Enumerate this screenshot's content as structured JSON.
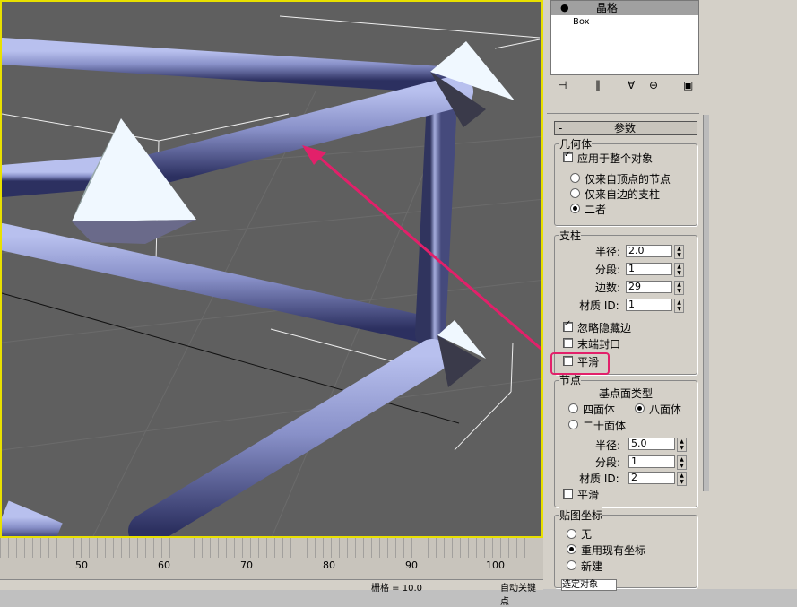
{
  "modifier_stack": {
    "items": [
      "晶格",
      "Box"
    ]
  },
  "rollout": {
    "title": "参数",
    "collapse": "-"
  },
  "geometry": {
    "title": "几何体",
    "apply_all": "应用于整个对象",
    "opt_vertices": "仅来自顶点的节点",
    "opt_edges": "仅来自边的支柱",
    "opt_both": "二者"
  },
  "struts": {
    "title": "支柱",
    "radius_label": "半径:",
    "radius": "2.0",
    "segments_label": "分段:",
    "segments": "1",
    "sides_label": "边数:",
    "sides": "29",
    "matid_label": "材质 ID:",
    "matid": "1",
    "ignore_hidden": "忽略隐藏边",
    "end_caps": "末端封口",
    "smooth": "平滑"
  },
  "joints": {
    "title": "节点",
    "base_type": "基点面类型",
    "tetra": "四面体",
    "octa": "八面体",
    "icosa": "二十面体",
    "radius_label": "半径:",
    "radius": "5.0",
    "segments_label": "分段:",
    "segments": "1",
    "matid_label": "材质 ID:",
    "matid": "2",
    "smooth": "平滑"
  },
  "mapping": {
    "title": "贴图坐标",
    "none": "无",
    "reuse": "重用现有坐标",
    "new": "新建"
  },
  "timeline": {
    "ticks": [
      "50",
      "60",
      "70",
      "80",
      "90",
      "100"
    ]
  },
  "statusbar": {
    "auto_key": "自动关键点",
    "selected": "选定对象",
    "grid": "栅格 = 10.0"
  },
  "colors": {
    "highlight": "#e2206a",
    "strut": "#8890c8",
    "joint": "#f0f8ff",
    "viewport_border": "#e8e000"
  }
}
